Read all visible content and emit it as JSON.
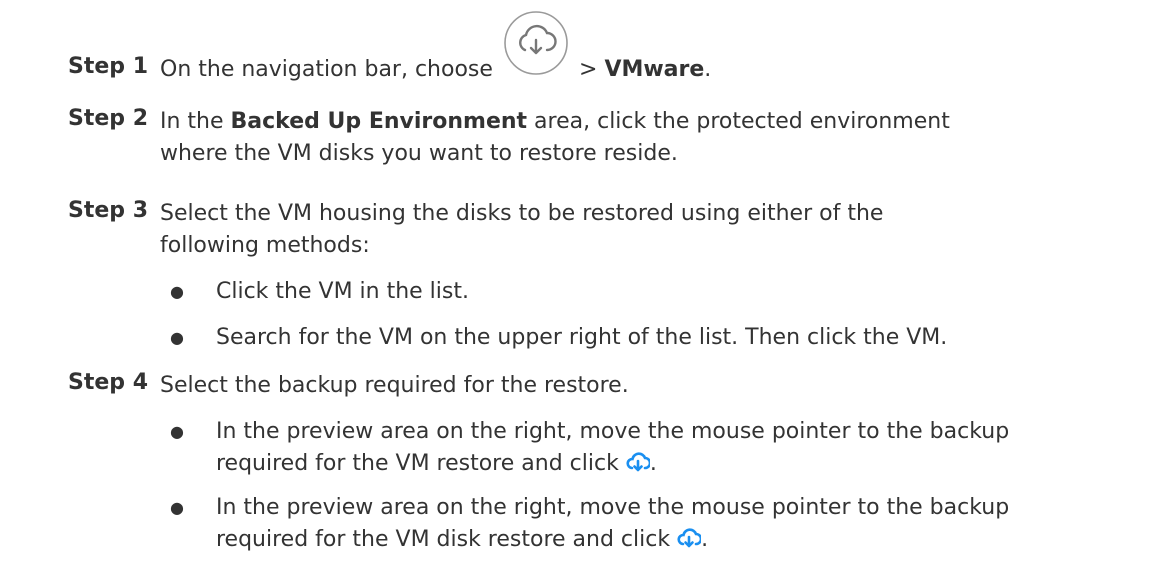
{
  "steps": [
    {
      "label": "Step 1",
      "pre": "On the navigation bar, choose",
      "icon": "cloud-restore-icon",
      "sep": " > ",
      "bold": "VMware",
      "post": "."
    },
    {
      "label": "Step 2",
      "pre": "In the ",
      "bold": "Backed Up Environment",
      "post": " area, click the protected environment where the VM disks you want to restore reside."
    },
    {
      "label": "Step 3",
      "text": "Select the VM housing the disks to be restored using either of the following methods:",
      "bullets": [
        "Click the VM in the list.",
        "Search for the VM on the upper right of the list. Then click the VM."
      ]
    },
    {
      "label": "Step 4",
      "text": "Select the backup required for the restore.",
      "bullets": [
        {
          "text": "In the preview area on the right, move the mouse pointer to the backup required for the VM restore and click",
          "icon": "cloud-restore-icon",
          "post": "."
        },
        {
          "text": "In the preview area on the right, move the mouse pointer to the backup required for the VM disk restore and click",
          "icon": "cloud-restore-icon",
          "post": "."
        }
      ]
    }
  ],
  "colors": {
    "text": "#333333",
    "icon_blue": "#1a8ff0",
    "icon_gray": "#8a8a8a"
  }
}
